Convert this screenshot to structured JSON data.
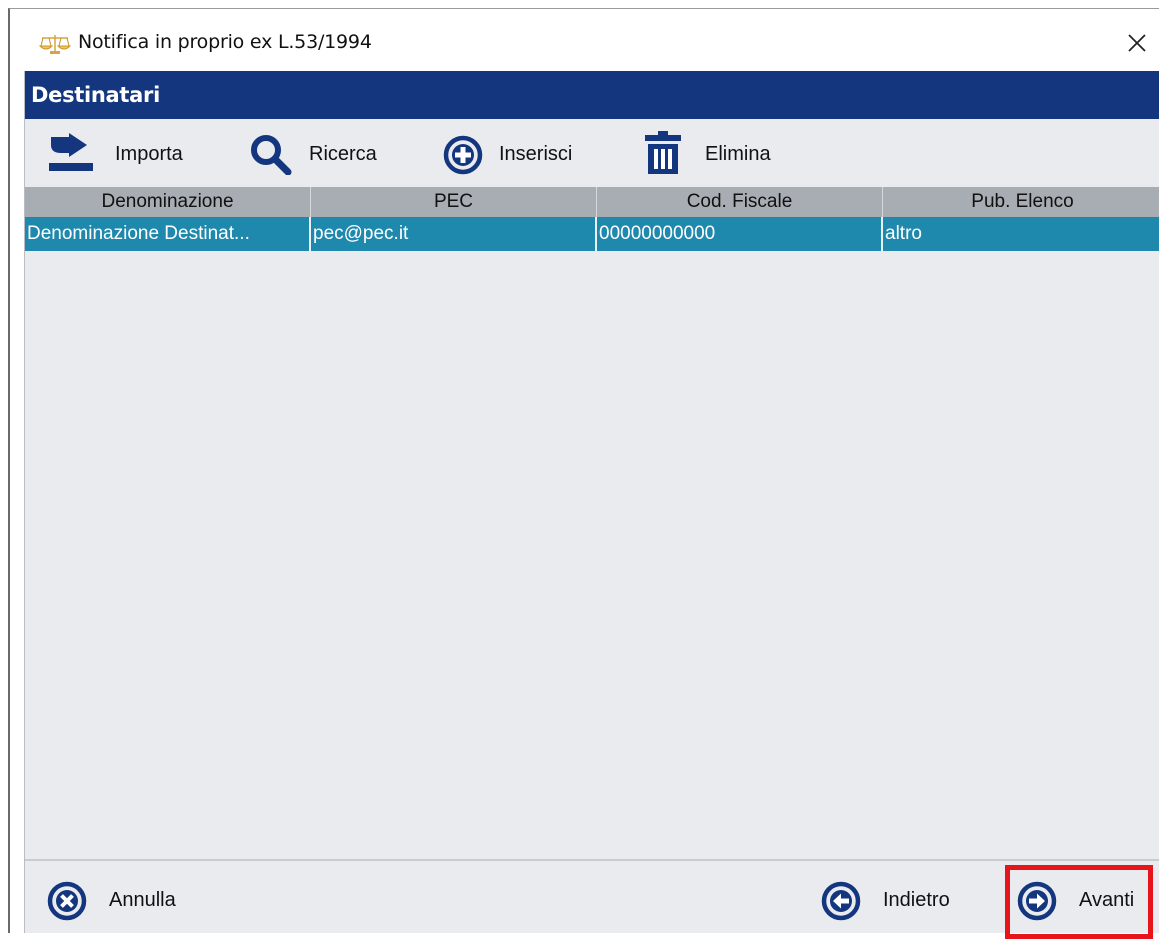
{
  "window": {
    "title": "Notifica in proprio ex L.53/1994",
    "close_glyph": "✕"
  },
  "header": {
    "title": "Destinatari"
  },
  "toolbar": {
    "import_label": "Importa",
    "search_label": "Ricerca",
    "insert_label": "Inserisci",
    "delete_label": "Elimina"
  },
  "table": {
    "columns": [
      "Denominazione",
      "PEC",
      "Cod. Fiscale",
      "Pub. Elenco"
    ],
    "rows": [
      {
        "denominazione": "Denominazione Destinat...",
        "pec": "pec@pec.it",
        "cod_fiscale": "00000000000",
        "pub_elenco": "altro"
      }
    ]
  },
  "footer": {
    "cancel_label": "Annulla",
    "back_label": "Indietro",
    "next_label": "Avanti"
  },
  "colors": {
    "header_bg": "#13367e",
    "icon_blue": "#13367e",
    "selected_row": "#1f88ad",
    "highlight_border": "#e8141b",
    "client_bg": "#e9ebef"
  },
  "icons": {
    "title": "scales-of-justice-icon",
    "import": "import-arrow-icon",
    "search": "magnifier-icon",
    "insert": "plus-circle-icon",
    "delete": "trash-icon",
    "cancel": "x-circle-icon",
    "back": "arrow-left-circle-icon",
    "next": "arrow-right-circle-icon"
  }
}
